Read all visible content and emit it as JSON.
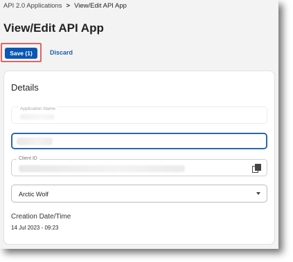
{
  "breadcrumb": {
    "parent": "API 2.0 Applications",
    "separator": ">",
    "current": "View/Edit API App"
  },
  "page": {
    "title": "View/Edit API App"
  },
  "toolbar": {
    "save_label": "Save (1)",
    "discard_label": "Discard"
  },
  "details": {
    "title": "Details",
    "application_name": {
      "label": "Application Name"
    },
    "client_id": {
      "label": "Client ID"
    },
    "organization": {
      "selected": "Arctic Wolf"
    },
    "creation": {
      "label": "Creation Date/Time",
      "value": "14 Jul 2023 - 09:23"
    }
  },
  "colors": {
    "primary": "#0a57b5",
    "highlight": "#e36464",
    "link": "#1b5fb0",
    "focus": "#2a67b1"
  },
  "icons": {
    "copy": "copy-icon",
    "dropdown": "chevron-down-icon"
  }
}
